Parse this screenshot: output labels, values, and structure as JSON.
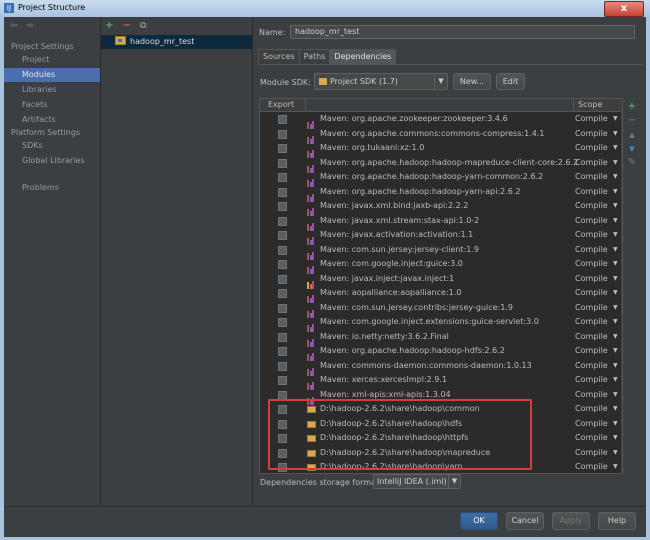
{
  "window": {
    "title": "Project Structure",
    "close_glyph": "x"
  },
  "nav": {
    "back": "⇦",
    "forward": "⇨",
    "project_settings": "Project Settings",
    "project_items": [
      "Project",
      "Modules",
      "Libraries",
      "Facets",
      "Artifacts"
    ],
    "selected": "Modules",
    "platform_settings": "Platform Settings",
    "platform_items": [
      "SDKs",
      "Global Libraries"
    ],
    "problems": "Problems"
  },
  "tree": {
    "add": "+",
    "remove": "−",
    "copy": "⧉",
    "module": "hadoop_mr_test"
  },
  "details": {
    "name_label": "Name:",
    "name_value": "hadoop_mr_test",
    "tabs": [
      "Sources",
      "Paths",
      "Dependencies"
    ],
    "active_tab": "Dependencies",
    "sdk_label": "Module SDK:",
    "sdk_value": "Project SDK (1.7)",
    "new_button": "New...",
    "edit_button": "Edit"
  },
  "table": {
    "col_export": "Export",
    "col_scope": "Scope",
    "rows": [
      {
        "name": "Maven: org.apache.zookeeper:zookeeper:3.4.6",
        "scope": "Compile",
        "kind": "lib"
      },
      {
        "name": "Maven: org.apache.commons:commons-compress:1.4.1",
        "scope": "Compile",
        "kind": "lib"
      },
      {
        "name": "Maven: org.tukaani:xz:1.0",
        "scope": "Compile",
        "kind": "lib"
      },
      {
        "name": "Maven: org.apache.hadoop:hadoop-mapreduce-client-core:2.6.2",
        "scope": "Compile",
        "kind": "lib"
      },
      {
        "name": "Maven: org.apache.hadoop:hadoop-yarn-common:2.6.2",
        "scope": "Compile",
        "kind": "lib"
      },
      {
        "name": "Maven: org.apache.hadoop:hadoop-yarn-api:2.6.2",
        "scope": "Compile",
        "kind": "lib"
      },
      {
        "name": "Maven: javax.xml.bind:jaxb-api:2.2.2",
        "scope": "Compile",
        "kind": "lib"
      },
      {
        "name": "Maven: javax.xml.stream:stax-api:1.0-2",
        "scope": "Compile",
        "kind": "lib"
      },
      {
        "name": "Maven: javax.activation:activation:1.1",
        "scope": "Compile",
        "kind": "lib"
      },
      {
        "name": "Maven: com.sun.jersey:jersey-client:1.9",
        "scope": "Compile",
        "kind": "lib"
      },
      {
        "name": "Maven: com.google.inject:guice:3.0",
        "scope": "Compile",
        "kind": "lib"
      },
      {
        "name": "Maven: javax.inject:javax.inject:1",
        "scope": "Compile",
        "kind": "lib2"
      },
      {
        "name": "Maven: aopalliance:aopalliance:1.0",
        "scope": "Compile",
        "kind": "lib"
      },
      {
        "name": "Maven: com.sun.jersey.contribs:jersey-guice:1.9",
        "scope": "Compile",
        "kind": "lib"
      },
      {
        "name": "Maven: com.google.inject.extensions:guice-servlet:3.0",
        "scope": "Compile",
        "kind": "lib"
      },
      {
        "name": "Maven: io.netty:netty:3.6.2.Final",
        "scope": "Compile",
        "kind": "lib"
      },
      {
        "name": "Maven: org.apache.hadoop:hadoop-hdfs:2.6.2",
        "scope": "Compile",
        "kind": "lib"
      },
      {
        "name": "Maven: commons-daemon:commons-daemon:1.0.13",
        "scope": "Compile",
        "kind": "lib"
      },
      {
        "name": "Maven: xerces:xercesImpl:2.9.1",
        "scope": "Compile",
        "kind": "lib"
      },
      {
        "name": "Maven: xml-apis:xml-apis:1.3.04",
        "scope": "Compile",
        "kind": "lib"
      },
      {
        "name": "D:\\hadoop-2.6.2\\share\\hadoop\\common",
        "scope": "Compile",
        "kind": "folder"
      },
      {
        "name": "D:\\hadoop-2.6.2\\share\\hadoop\\hdfs",
        "scope": "Compile",
        "kind": "folder"
      },
      {
        "name": "D:\\hadoop-2.6.2\\share\\hadoop\\httpfs",
        "scope": "Compile",
        "kind": "folder"
      },
      {
        "name": "D:\\hadoop-2.6.2\\share\\hadoop\\mapreduce",
        "scope": "Compile",
        "kind": "folder"
      },
      {
        "name": "D:\\hadoop-2.6.2\\share\\hadoop\\yarn",
        "scope": "Compile",
        "kind": "folder"
      }
    ]
  },
  "side_tools": {
    "add": "+",
    "remove": "−",
    "up": "▲",
    "down": "▼",
    "edit": "✎"
  },
  "storage": {
    "label": "Dependencies storage format:",
    "value": "IntelliJ IDEA (.iml)"
  },
  "buttons": {
    "ok": "OK",
    "cancel": "Cancel",
    "apply": "Apply",
    "help": "Help"
  },
  "colors": {
    "selection": "#4b6eaf",
    "highlight_box": "#d83b3b",
    "ok_button": "#2f5a8c"
  }
}
